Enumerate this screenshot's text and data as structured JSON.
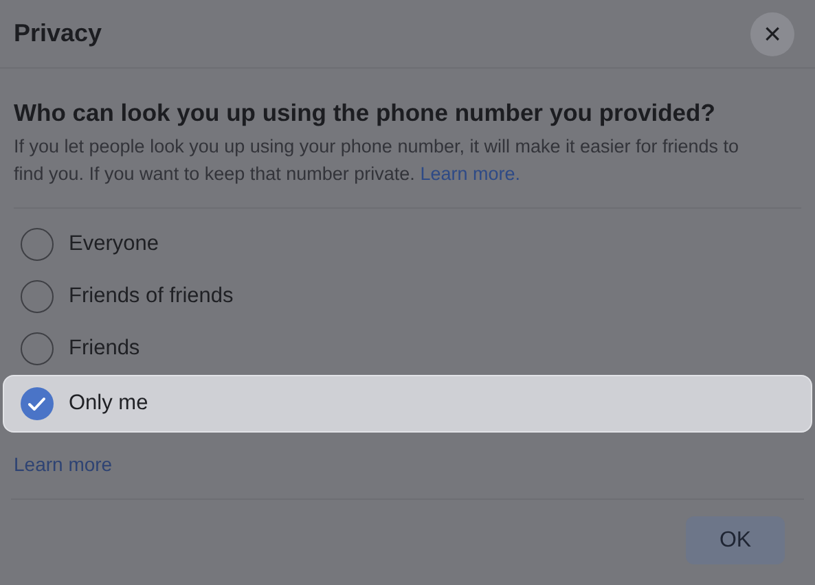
{
  "dialog": {
    "title": "Privacy",
    "close": "×"
  },
  "question": "Who can look you up using the phone number you provided?",
  "description": {
    "text": "If you let people look you up using your phone number, it will make it easier for friends to find you. If you want to keep that number private.",
    "link": "Learn more."
  },
  "options": [
    {
      "label": "Everyone",
      "selected": false
    },
    {
      "label": "Friends of friends",
      "selected": false
    },
    {
      "label": "Friends",
      "selected": false
    },
    {
      "label": "Only me",
      "selected": true
    }
  ],
  "learn_more": "Learn more",
  "buttons": [
    "OK"
  ]
}
